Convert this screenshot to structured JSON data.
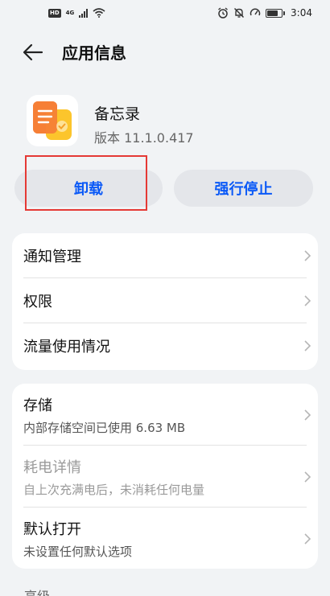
{
  "status_bar": {
    "hd_badge": "HD",
    "network_label": "4G",
    "time": "3:04",
    "battery_level": 0.75,
    "icons": [
      "hd-icon",
      "signal-icon",
      "wifi-icon",
      "alarm-icon",
      "mute-icon",
      "speed-icon",
      "battery-icon"
    ]
  },
  "header": {
    "title": "应用信息",
    "back_icon": "back-arrow-icon"
  },
  "app": {
    "name": "备忘录",
    "version": "版本 11.1.0.417",
    "icon": "notes-app-icon"
  },
  "actions": {
    "uninstall": "卸载",
    "force_stop": "强行停止"
  },
  "section1": {
    "items": [
      {
        "title": "通知管理"
      },
      {
        "title": "权限"
      },
      {
        "title": "流量使用情况"
      }
    ]
  },
  "section2": {
    "items": [
      {
        "title": "存储",
        "subtitle": "内部存储空间已使用 6.63 MB"
      },
      {
        "title": "耗电详情",
        "subtitle": "自上次充满电后，未消耗任何电量"
      },
      {
        "title": "默认打开",
        "subtitle": "未设置任何默认选项"
      }
    ]
  },
  "partial_section_label": "高级",
  "colors": {
    "accent": "#0a59f7",
    "background": "#f1f3f5",
    "highlight": "#e53935"
  }
}
